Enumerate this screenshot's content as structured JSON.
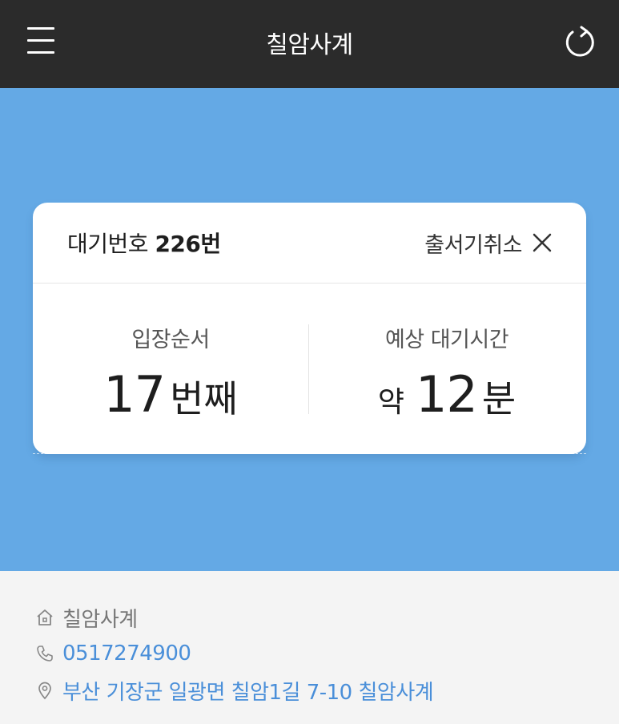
{
  "header": {
    "title": "칠암사계"
  },
  "ticket": {
    "number_label": "대기번호",
    "number_value": "226번",
    "cancel_label": "출서기취소",
    "order_label": "입장순서",
    "order_value": "17",
    "order_unit": "번째",
    "time_label": "예상 대기시간",
    "time_prefix": "약",
    "time_value": "12",
    "time_unit": "분"
  },
  "store": {
    "name": "칠암사계",
    "phone": "0517274900",
    "address": "부산 기장군 일광면 칠암1길 7-10 칠암사계"
  },
  "colors": {
    "topbar": "#2b2b2b",
    "hero": "#64a9e5",
    "link": "#4a8fd9"
  },
  "icons": [
    "menu-icon",
    "refresh-icon",
    "close-icon",
    "home-icon",
    "phone-icon",
    "location-pin-icon"
  ]
}
